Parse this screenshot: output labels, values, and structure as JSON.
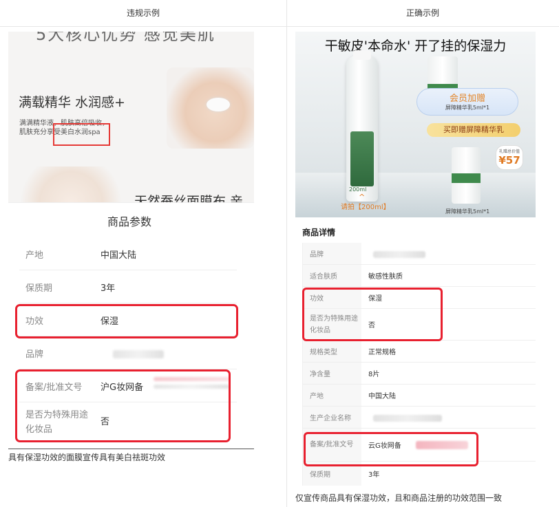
{
  "header": {
    "left_label": "违规示例",
    "right_label": "正确示例"
  },
  "left": {
    "promo": {
      "top_text": "5大核心优势 感觉美肌",
      "title": "满载精华  水润感+",
      "desc_line1": "满满精华液，肌肤高倍吸收，",
      "desc_line2": "肌肤充分享受美白水润spa",
      "bottom_text": "天然蚕丝面膜布 亲"
    },
    "params_title": "商品参数",
    "params": [
      {
        "key": "产地",
        "value": "中国大陆"
      },
      {
        "key": "保质期",
        "value": "3年"
      },
      {
        "key": "功效",
        "value": "保湿"
      },
      {
        "key": "品牌",
        "value": ""
      },
      {
        "key": "备案/批准文号",
        "value": "沪G妆网备"
      },
      {
        "key": "是否为特殊用途化妆品",
        "value": "否"
      }
    ],
    "caption": "具有保湿功效的面膜宣传具有美白祛斑功效"
  },
  "right": {
    "ad": {
      "title": "干敏皮'本命水' 开了挂的保湿力",
      "member_gift": "会员加赠",
      "member_gift_sub": "屏障精华乳5ml*1",
      "buy_gift": "买即赠屏障精华乳",
      "price_label": "礼赠总价值",
      "price": "¥57",
      "volume": "请拍【200ml】",
      "bottle_volume": "200ml",
      "tube_label": "屏障精华乳5ml*1"
    },
    "details_title": "商品详情",
    "details": [
      {
        "key": "品牌",
        "value": ""
      },
      {
        "key": "适合肤质",
        "value": "敏感性肤质"
      },
      {
        "key": "功效",
        "value": "保湿"
      },
      {
        "key": "是否为特殊用途化妆品",
        "value": "否"
      },
      {
        "key": "规格类型",
        "value": "正常规格"
      },
      {
        "key": "净含量",
        "value": "8片"
      },
      {
        "key": "产地",
        "value": "中国大陆"
      },
      {
        "key": "生产企业名称",
        "value": ""
      },
      {
        "key": "备案/批准文号",
        "value": "云G妆网备"
      },
      {
        "key": "保质期",
        "value": "3年"
      }
    ],
    "caption": "仅宣传商品具有保湿功效，且和商品注册的功效范围一致"
  },
  "colors": {
    "highlight_red": "#e8202f",
    "accent_orange": "#e07a23"
  }
}
